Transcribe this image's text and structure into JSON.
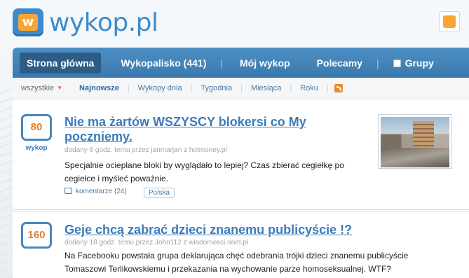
{
  "logo": {
    "text": "wykop.pl",
    "mark_glyph": "w"
  },
  "mainnav": {
    "items": [
      {
        "label": "Strona główna"
      },
      {
        "label": "Wykopalisko (441)"
      },
      {
        "label": "Mój wykop"
      },
      {
        "label": "Polecamy"
      },
      {
        "label": "Grupy"
      }
    ]
  },
  "subnav": {
    "filter": "wszystkie",
    "items": [
      {
        "label": "Najnowsze"
      },
      {
        "label": "Wykopy dnia"
      },
      {
        "label": "Tygodnia"
      },
      {
        "label": "Miesiąca"
      },
      {
        "label": "Roku"
      }
    ]
  },
  "entries": [
    {
      "votes": "80",
      "vote_label": "wykop",
      "title": "Nie ma żartów WSZYSCY blokersi co My poczniemy.",
      "meta": "dodany 6 godz. temu przez janmarjan z hotmoney.pl",
      "desc": "Specjalnie ocieplane bloki by wyglądało to lepiej? Czas zbierać cegiełkę po cegiełce i myśleć poważnie.",
      "comments": "komentarze (24)",
      "tag": "Polska"
    },
    {
      "votes": "160",
      "title": "Geje chcą zabrać dzieci znanemu publicyście !?",
      "meta": "dodany 18 godz. temu przez John112 z wiadomosci.onet.pl",
      "desc": "Na Facebooku powstała grupa deklarująca chęć odebrania trójki dzieci znanemu publicyście Tomaszowi Terlikowskiemu i przekazania na wychowanie parze homoseksualnej. WTF?"
    }
  ],
  "colors": {
    "accent": "#3a7cba",
    "vote": "#e67e22",
    "nav": "#3b79ad"
  }
}
